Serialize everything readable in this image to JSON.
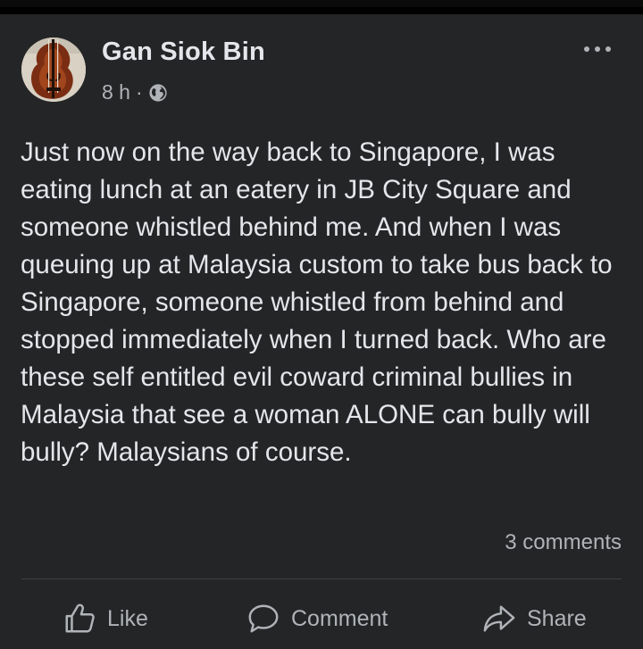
{
  "post": {
    "author": "Gan Siok Bin",
    "timestamp": "8 h",
    "separator": "·",
    "audience_icon": "globe-icon",
    "more_icon": "more-options-icon",
    "text": "Just now on the way back to Singapore, I was eating lunch at an eatery in JB City Square and someone whistled behind me. And when I was queuing up at Malaysia custom to take bus back to Singapore, someone whistled from behind and stopped immediately when I turned back. Who are these self entitled evil coward criminal bullies in Malaysia that see a woman ALONE can bully will bully? Malaysians of course.",
    "comments_count": "3 comments"
  },
  "actions": {
    "like_label": "Like",
    "comment_label": "Comment",
    "share_label": "Share"
  },
  "colors": {
    "card_background": "#242526",
    "page_background": "#000000",
    "primary_text": "#e4e6eb",
    "secondary_text": "#b0b3b8",
    "divider": "#3e4042"
  }
}
